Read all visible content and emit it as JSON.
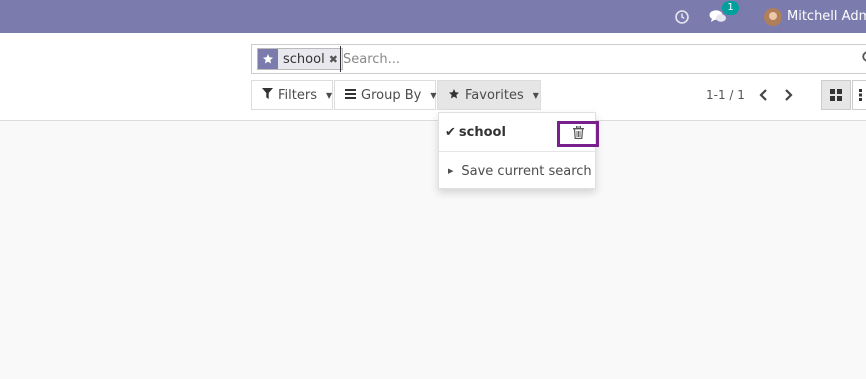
{
  "navbar": {
    "icons": [
      "clock-icon",
      "chat-icon"
    ],
    "chat_badge": "1",
    "user_name": "Mitchell Admi",
    "color": "#7c7bad"
  },
  "search": {
    "facet_icon": "star-icon",
    "facet_value": "school",
    "placeholder": "Search..."
  },
  "buttons": {
    "filters": "Filters",
    "group_by": "Group By",
    "favorites": "Favorites"
  },
  "pager": {
    "value": "1-1 / 1"
  },
  "favorites_menu": {
    "items": [
      {
        "label": "school",
        "checked": true
      },
      {
        "label": "Save current search"
      }
    ],
    "highlight_color": "#7a1f8e"
  }
}
